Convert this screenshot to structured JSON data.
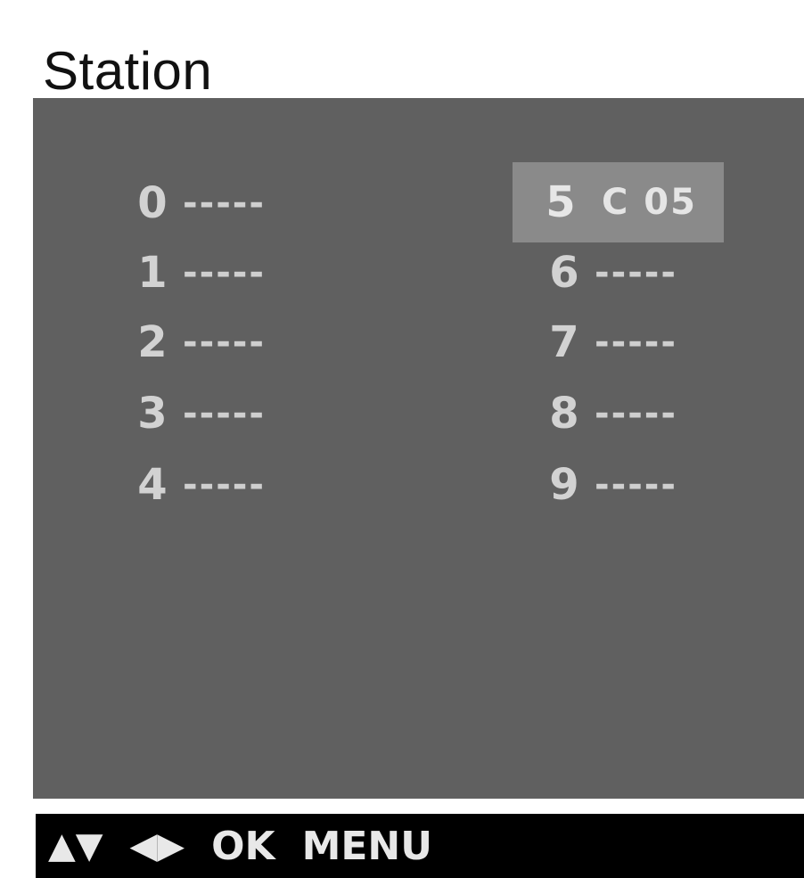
{
  "header": {
    "title": "Station"
  },
  "stations": {
    "left": [
      {
        "number": "0",
        "name": "-----"
      },
      {
        "number": "1",
        "name": "-----"
      },
      {
        "number": "2",
        "name": "-----"
      },
      {
        "number": "3",
        "name": "-----"
      },
      {
        "number": "4",
        "name": "-----"
      }
    ],
    "right": [
      {
        "number": "5",
        "name": "C 05",
        "selected": true
      },
      {
        "number": "6",
        "name": "-----"
      },
      {
        "number": "7",
        "name": "-----"
      },
      {
        "number": "8",
        "name": "-----"
      },
      {
        "number": "9",
        "name": "-----"
      }
    ]
  },
  "footer": {
    "updown_icon": "▲▼",
    "leftright_icon": "◀▶",
    "ok_label": "OK",
    "menu_label": "MENU"
  },
  "colors": {
    "panel_bg": "#606060",
    "selected_bg": "#8a8a8a",
    "text": "#dcdcdc",
    "footer_bg": "#000000"
  }
}
